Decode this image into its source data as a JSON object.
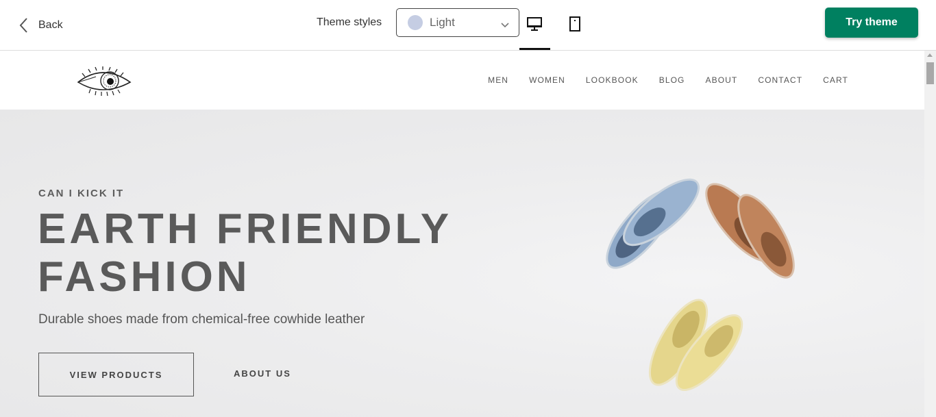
{
  "toolbar": {
    "back_label": "Back",
    "theme_styles_label": "Theme styles",
    "style_select": {
      "value": "Light",
      "swatch_color": "#c5cde3"
    },
    "device_modes": [
      "desktop",
      "mobile"
    ],
    "active_device": "desktop",
    "try_button_label": "Try theme",
    "accent_color": "#008060"
  },
  "store": {
    "logo": "eye-logo",
    "nav": [
      "MEN",
      "WOMEN",
      "LOOKBOOK",
      "BLOG",
      "ABOUT",
      "CONTACT",
      "CART"
    ],
    "hero": {
      "eyebrow": "CAN I KICK IT",
      "headline": "EARTH FRIENDLY FASHION",
      "subhead": "Durable shoes made from chemical-free cowhide leather",
      "primary_button": "VIEW PRODUCTS",
      "secondary_button": "ABOUT US",
      "image": "shoes-photo",
      "shoe_colors": [
        "#8fa9c8",
        "#b97a52",
        "#e5d68c"
      ]
    }
  }
}
